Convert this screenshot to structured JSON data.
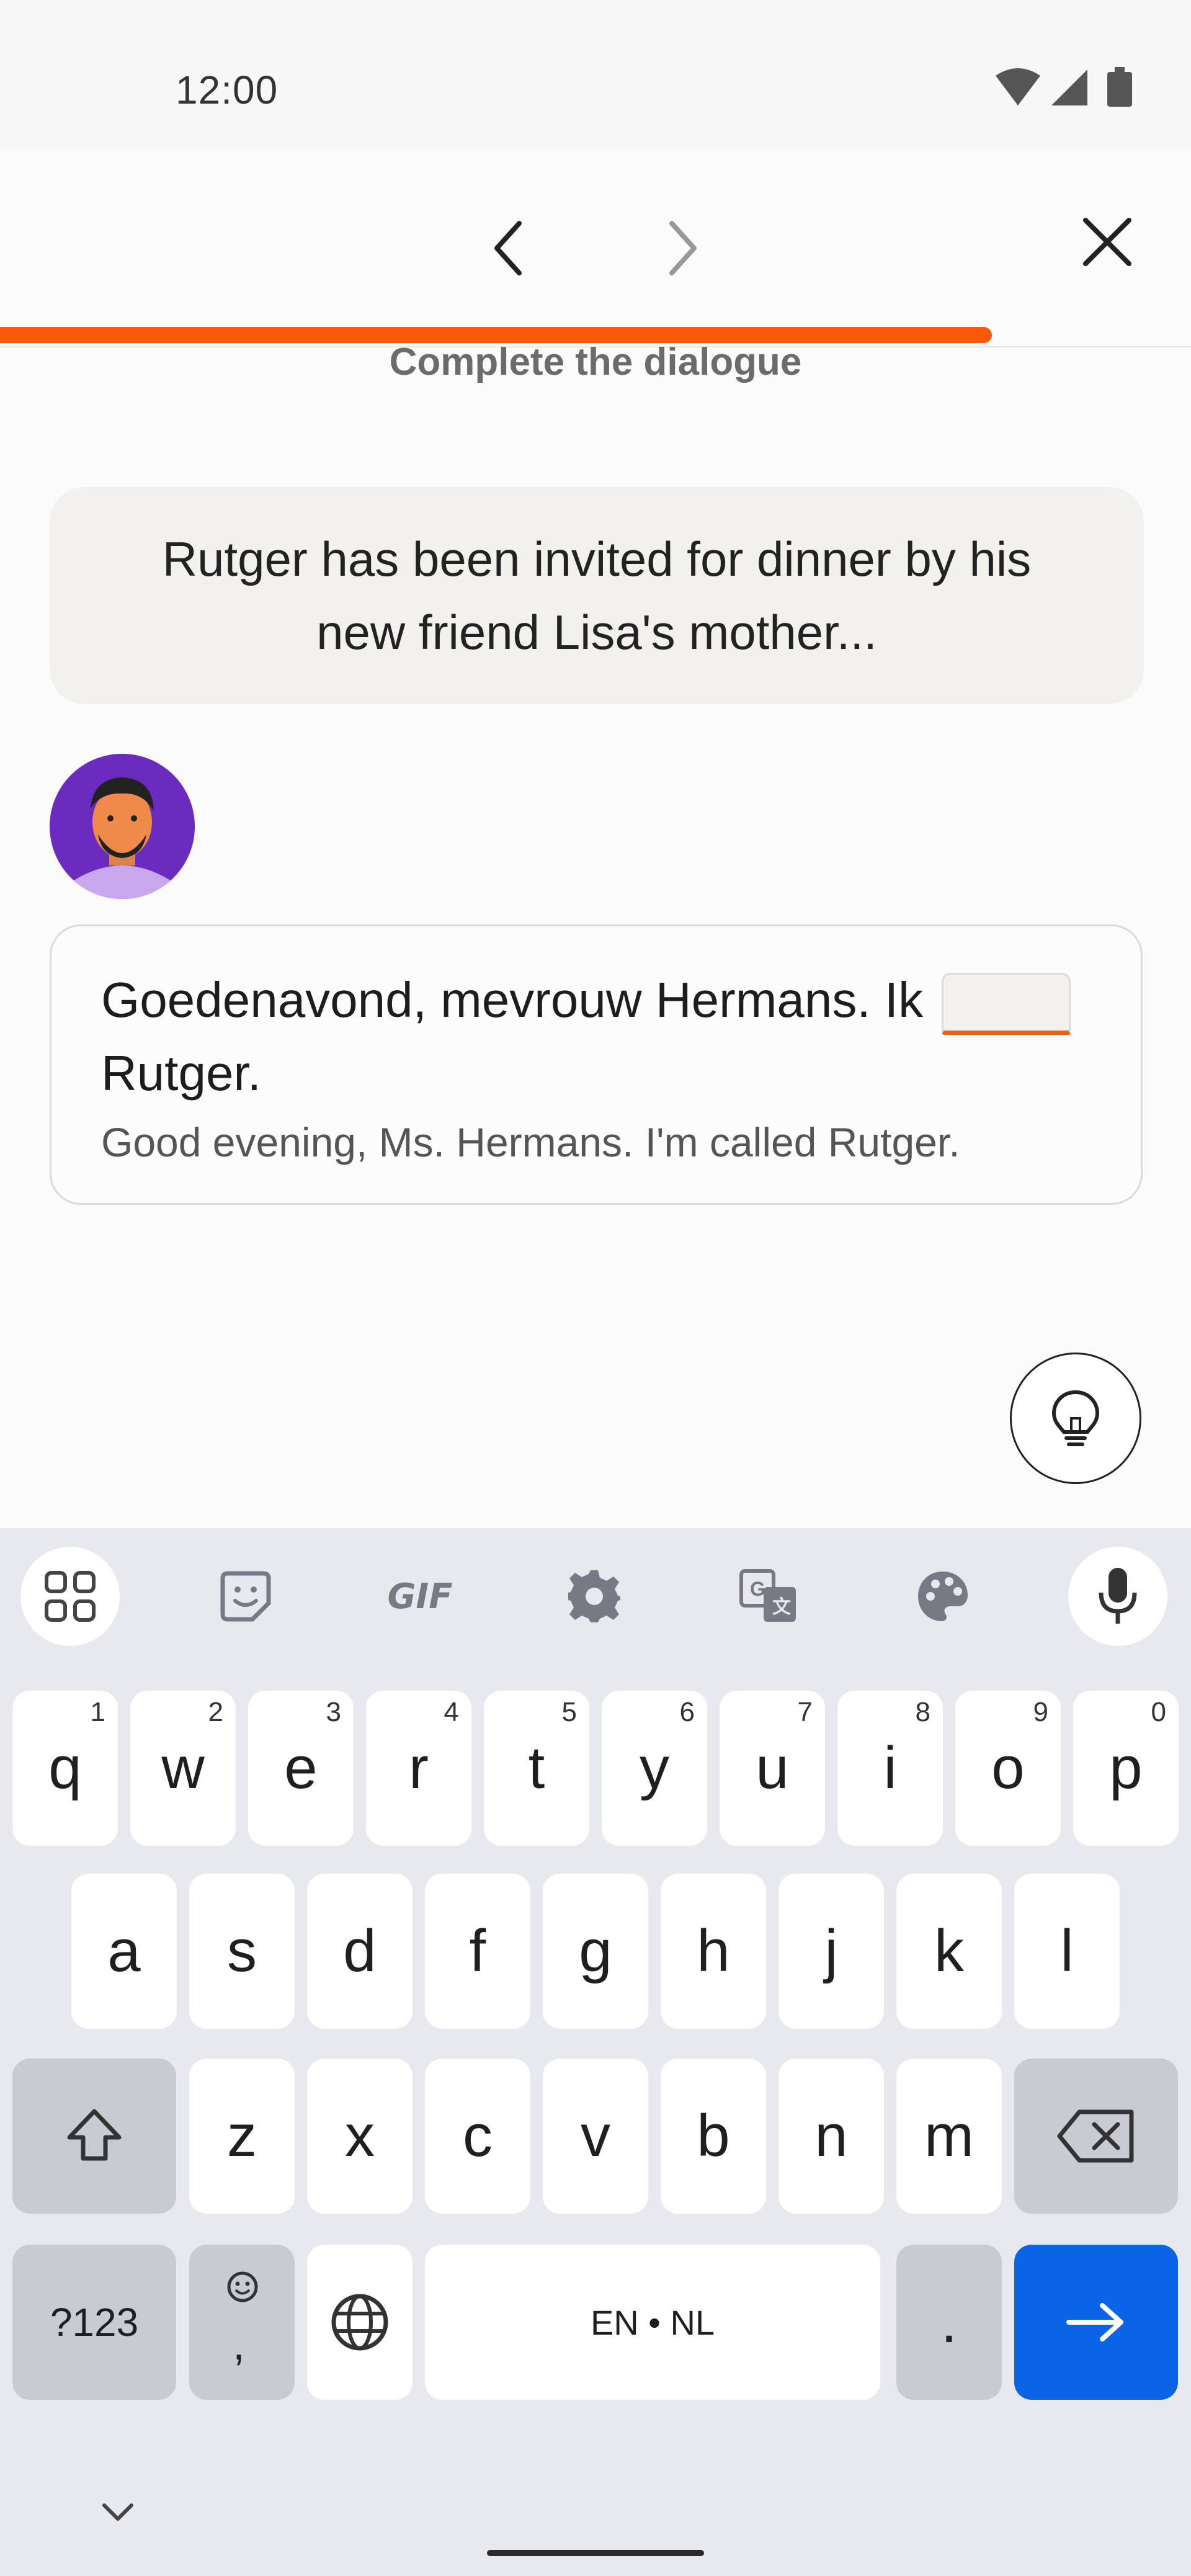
{
  "status_bar": {
    "time": "12:00",
    "icons": [
      "wifi-icon",
      "cell-signal-icon",
      "battery-icon"
    ]
  },
  "nav": {
    "back_icon": "chevron-left-icon",
    "forward_icon": "chevron-right-icon",
    "close_icon": "close-icon",
    "progress": 0.833,
    "accent": "#fa5a0a"
  },
  "exercise": {
    "instruction": "Complete the dialogue",
    "context": "Rutger has been invited for dinner by his new friend Lisa's mother...",
    "dialogue": {
      "before_blank": "Goedenavond, mevrouw Hermans. Ik",
      "after_blank": "Rutger.",
      "blank_value": "",
      "translation": "Good evening, Ms. Hermans. I'm called Rutger."
    },
    "hint_icon": "lightbulb-icon"
  },
  "keyboard": {
    "toolbar": [
      "apps-grid-icon",
      "sticker-icon",
      "GIF",
      "settings-gear-icon",
      "translate-icon",
      "palette-icon",
      "microphone-icon"
    ],
    "gif_label": "GIF",
    "row1": [
      {
        "k": "q",
        "n": "1"
      },
      {
        "k": "w",
        "n": "2"
      },
      {
        "k": "e",
        "n": "3"
      },
      {
        "k": "r",
        "n": "4"
      },
      {
        "k": "t",
        "n": "5"
      },
      {
        "k": "y",
        "n": "6"
      },
      {
        "k": "u",
        "n": "7"
      },
      {
        "k": "i",
        "n": "8"
      },
      {
        "k": "o",
        "n": "9"
      },
      {
        "k": "p",
        "n": "0"
      }
    ],
    "row2": [
      "a",
      "s",
      "d",
      "f",
      "g",
      "h",
      "j",
      "k",
      "l"
    ],
    "row3": [
      "z",
      "x",
      "c",
      "v",
      "b",
      "n",
      "m"
    ],
    "symbols_label": "?123",
    "emoji_comma": ",",
    "space_label": "EN • NL",
    "period": ".",
    "enter_color": "#0b63e6"
  }
}
